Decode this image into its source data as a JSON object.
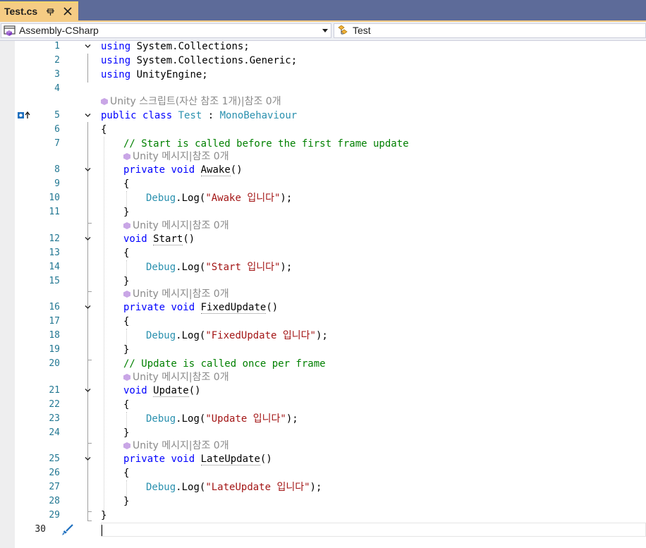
{
  "tab": {
    "title": "Test.cs",
    "pin_icon": "pin-icon",
    "close_icon": "close-icon"
  },
  "navbar": {
    "project": "Assembly-CSharp",
    "project_icon": "project-icon",
    "member": "Test",
    "member_icon": "class-members-icon"
  },
  "codelens": {
    "script": "Unity 스크립트(자산 참조 1개)|참조 0개",
    "message": "Unity 메시지|참조 0개"
  },
  "code": {
    "l1_kw": "using",
    "l1_rest": " System.Collections;",
    "l2_kw": "using",
    "l2_rest": " System.Collections.Generic;",
    "l3_kw": "using",
    "l3_rest": " UnityEngine;",
    "l5_kw1": "public",
    "l5_kw2": "class",
    "l5_name": "Test",
    "l5_colon": " : ",
    "l5_base": "MonoBehaviour",
    "brace_open": "{",
    "brace_close": "}",
    "l7_comment": "// Start is called before the first frame update",
    "l8_kw1": "private",
    "l8_kw2": "void",
    "l8_name": "Awake",
    "paren": "()",
    "l10_type": "Debug",
    "l10_dot": ".Log(",
    "l10_str": "\"Awake 입니다\"",
    "l10_end": ");",
    "l12_kw": "void",
    "l12_name": "Start",
    "l14_type": "Debug",
    "l14_dot": ".Log(",
    "l14_str": "\"Start 입니다\"",
    "l14_end": ");",
    "l16_kw1": "private",
    "l16_kw2": "void",
    "l16_name": "FixedUpdate",
    "l18_type": "Debug",
    "l18_dot": ".Log(",
    "l18_str": "\"FixedUpdate 입니다\"",
    "l18_end": ");",
    "l20_comment": "// Update is called once per frame",
    "l21_kw": "void",
    "l21_name": "Update",
    "l23_type": "Debug",
    "l23_dot": ".Log(",
    "l23_str": "\"Update 입니다\"",
    "l23_end": ");",
    "l25_kw1": "private",
    "l25_kw2": "void",
    "l25_name": "LateUpdate",
    "l27_type": "Debug",
    "l27_dot": ".Log(",
    "l27_str": "\"LateUpdate 입니다\"",
    "l27_end": ");"
  },
  "line_numbers": [
    "1",
    "2",
    "3",
    "4",
    "5",
    "6",
    "7",
    "8",
    "9",
    "10",
    "11",
    "12",
    "13",
    "14",
    "15",
    "16",
    "17",
    "18",
    "19",
    "20",
    "21",
    "22",
    "23",
    "24",
    "25",
    "26",
    "27",
    "28",
    "29",
    "30"
  ],
  "colors": {
    "keyword": "#0000ff",
    "type": "#2b91af",
    "comment": "#008000",
    "string": "#a31515",
    "line_number": "#237893",
    "tab_active": "#f5cc84",
    "tabbar": "#5d6b99"
  }
}
